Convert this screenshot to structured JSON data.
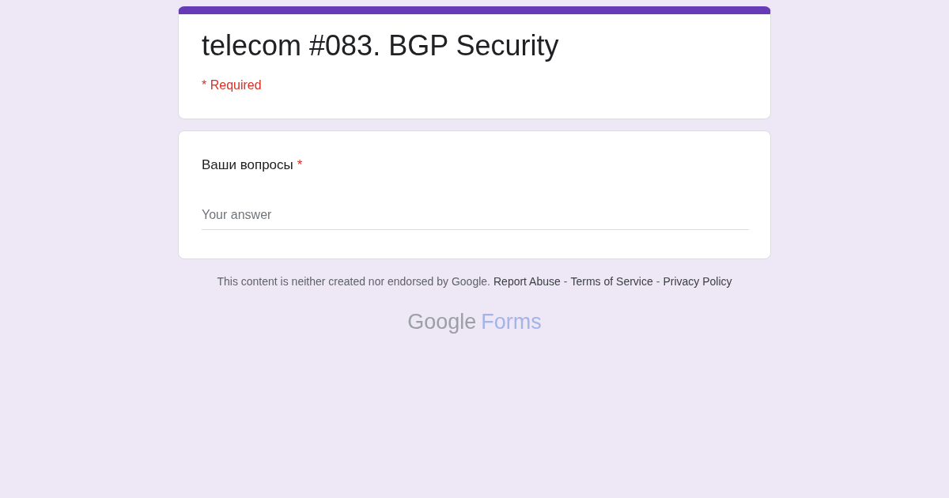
{
  "header": {
    "title": "telecom #083. BGP Security",
    "required_note": "* Required"
  },
  "questions": [
    {
      "label": "Ваши вопросы",
      "required": true,
      "required_mark": "*",
      "placeholder": "Your answer"
    }
  ],
  "footer": {
    "disclaimer": "This content is neither created nor endorsed by Google.",
    "links": [
      "Report Abuse",
      "Terms of Service",
      "Privacy Policy"
    ],
    "separator": "-"
  },
  "logo": {
    "brand": "Google",
    "product": "Forms"
  }
}
